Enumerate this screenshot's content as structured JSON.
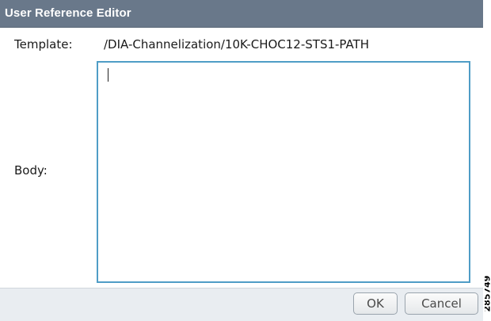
{
  "dialog": {
    "title": "User Reference Editor",
    "template_label": "Template:",
    "template_value": "/DIA-Channelization/10K-CHOC12-STS1-PATH",
    "body_label": "Body:",
    "body_value": "",
    "ok_label": "OK",
    "cancel_label": "Cancel"
  },
  "side_id": "285749",
  "colors": {
    "titlebar": "#69788a",
    "textarea_border": "#4f9dc6",
    "footer": "#e9edf1"
  }
}
